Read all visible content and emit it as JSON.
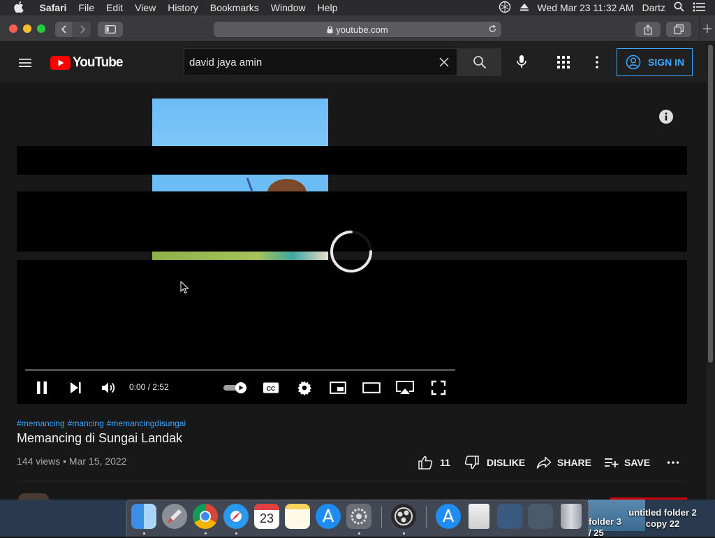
{
  "menubar": {
    "app_name": "Safari",
    "items": [
      "File",
      "Edit",
      "View",
      "History",
      "Bookmarks",
      "Window",
      "Help"
    ],
    "clock": "Wed Mar 23  11:32 AM",
    "user": "Dartz"
  },
  "browser": {
    "url": "youtube.com"
  },
  "youtube": {
    "logo_text": "YouTube",
    "search_query": "david jaya amin",
    "sign_in_label": "SIGN IN"
  },
  "player": {
    "time_current": "0:00",
    "time_total": "2:52",
    "time_display": "0:00 / 2:52",
    "progress_fraction": 0,
    "state": "loading"
  },
  "video": {
    "hashtags": [
      "#memancing",
      "#mancing",
      "#memancingdisungai"
    ],
    "title": "Memancing di Sungai Landak",
    "views": "144 views",
    "date": "Mar 15, 2022",
    "meta_line": "144 views • Mar 15, 2022",
    "likes": "11",
    "dislike_label": "DISLIKE",
    "share_label": "SHARE",
    "save_label": "SAVE"
  },
  "desktop": {
    "files": [
      {
        "label": "untitled folder 2 copy 22"
      },
      {
        "label": "folder 3"
      },
      {
        "label": "/ 25"
      }
    ]
  },
  "colors": {
    "youtube_red": "#ff0000",
    "link_blue": "#3ea6ff",
    "background": "#181818"
  }
}
